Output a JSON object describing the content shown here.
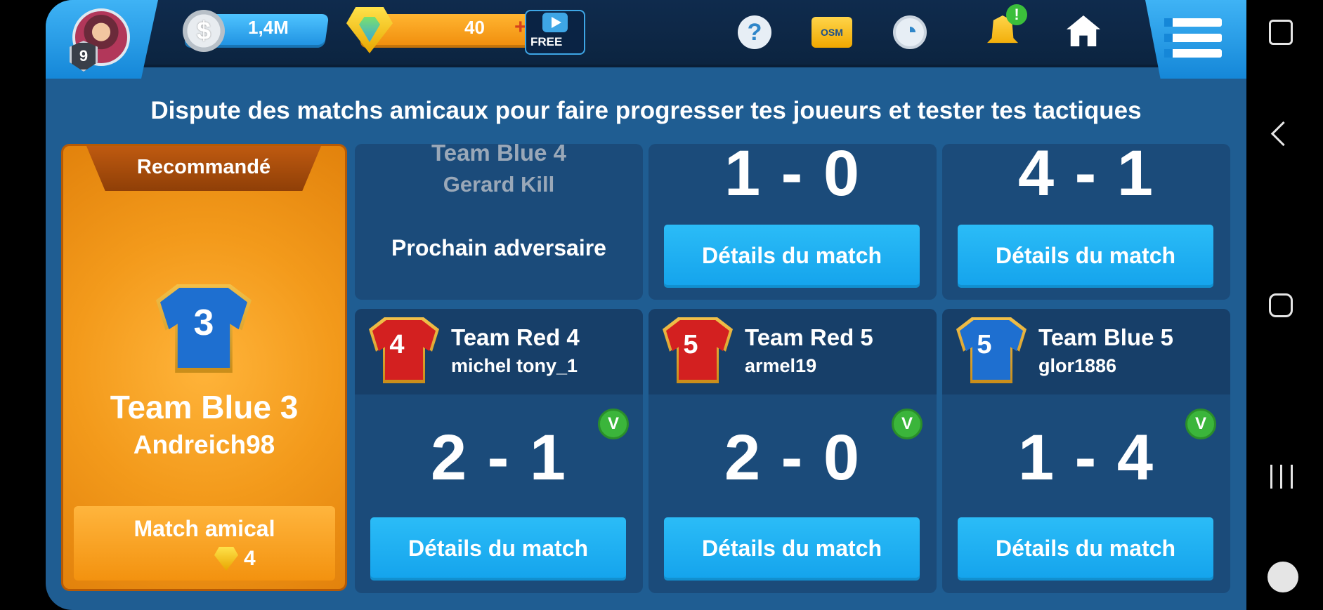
{
  "topbar": {
    "level": "9",
    "coins": "1,4M",
    "gems": "40",
    "gems_plus": "+",
    "free_label": "FREE",
    "osm_label": "OSM",
    "help_symbol": "?",
    "notification_symbol": "!"
  },
  "subtitle": "Dispute des matchs amicaux pour faire progresser tes joueurs et tester tes tactiques",
  "recommended": {
    "ribbon": "Recommandé",
    "jersey_number": "3",
    "jersey_color": "#1e6fd0",
    "team": "Team Blue 3",
    "manager": "Andreich98",
    "button_label": "Match amical",
    "cost": "4"
  },
  "top_row": {
    "next": {
      "team": "Team Blue 4",
      "manager": "Gerard Kill",
      "label": "Prochain adversaire"
    },
    "match_a": {
      "score": "1 - 0",
      "button": "Détails du match"
    },
    "match_b": {
      "score": "4 - 1",
      "button": "Détails du match"
    }
  },
  "matches": [
    {
      "jersey_number": "4",
      "jersey_color": "#d32020",
      "team": "Team Red 4",
      "manager": "michel tony_1",
      "result": "V",
      "score": "2 - 1",
      "button": "Détails du match"
    },
    {
      "jersey_number": "5",
      "jersey_color": "#d32020",
      "team": "Team Red 5",
      "manager": "armel19",
      "result": "V",
      "score": "2 - 0",
      "button": "Détails du match"
    },
    {
      "jersey_number": "5",
      "jersey_color": "#1e6fd0",
      "team": "Team Blue 5",
      "manager": "glor1886",
      "result": "V",
      "score": "1 - 4",
      "button": "Détails du match"
    }
  ],
  "colors": {
    "background": "#1f5d92",
    "cell": "#1b4b7a",
    "accent_blue": "#14a3ec",
    "accent_orange": "#f39a1b",
    "win_green": "#3bb53b"
  },
  "icons": {
    "coin": "coin-icon",
    "gem": "gem-icon",
    "free_video": "video-icon",
    "help": "help-icon",
    "shop": "osm-bag-icon",
    "timer": "clock-icon",
    "notification": "bell-icon",
    "home": "home-icon",
    "menu": "menu-icon"
  }
}
